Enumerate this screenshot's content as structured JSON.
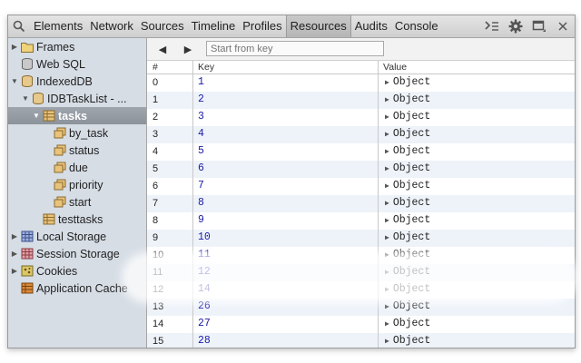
{
  "toolbar": {
    "tabs": [
      "Elements",
      "Network",
      "Sources",
      "Timeline",
      "Profiles",
      "Resources",
      "Audits",
      "Console"
    ],
    "active_tab": "Resources"
  },
  "sidebar": {
    "items": [
      {
        "label": "Frames",
        "icon": "folder-icon",
        "expanded": false
      },
      {
        "label": "Web SQL",
        "icon": "database-icon",
        "expanded": null
      },
      {
        "label": "IndexedDB",
        "icon": "database-icon",
        "expanded": true
      },
      {
        "label": "IDBTaskList - ...",
        "icon": "database-icon",
        "expanded": true
      },
      {
        "label": "tasks",
        "icon": "object-store-icon",
        "expanded": true,
        "selected": true
      },
      {
        "label": "by_task",
        "icon": "index-icon"
      },
      {
        "label": "status",
        "icon": "index-icon"
      },
      {
        "label": "due",
        "icon": "index-icon"
      },
      {
        "label": "priority",
        "icon": "index-icon"
      },
      {
        "label": "start",
        "icon": "index-icon"
      },
      {
        "label": "testtasks",
        "icon": "object-store-icon"
      },
      {
        "label": "Local Storage",
        "icon": "storage-grid-icon",
        "expanded": false
      },
      {
        "label": "Session Storage",
        "icon": "storage-grid-icon",
        "expanded": false
      },
      {
        "label": "Cookies",
        "icon": "cookie-icon",
        "expanded": false
      },
      {
        "label": "Application Cache",
        "icon": "app-cache-icon"
      }
    ]
  },
  "nav": {
    "prev_label": "◀",
    "next_label": "▶",
    "key_placeholder": "Start from key"
  },
  "grid": {
    "columns": [
      "#",
      "Key",
      "Value"
    ],
    "rows": [
      {
        "n": "0",
        "key": "1",
        "value": "Object"
      },
      {
        "n": "1",
        "key": "2",
        "value": "Object"
      },
      {
        "n": "2",
        "key": "3",
        "value": "Object"
      },
      {
        "n": "3",
        "key": "4",
        "value": "Object"
      },
      {
        "n": "4",
        "key": "5",
        "value": "Object"
      },
      {
        "n": "5",
        "key": "6",
        "value": "Object"
      },
      {
        "n": "6",
        "key": "7",
        "value": "Object"
      },
      {
        "n": "7",
        "key": "8",
        "value": "Object"
      },
      {
        "n": "8",
        "key": "9",
        "value": "Object"
      },
      {
        "n": "9",
        "key": "10",
        "value": "Object"
      },
      {
        "n": "10",
        "key": "11",
        "value": "Object"
      },
      {
        "n": "11",
        "key": "12",
        "value": "Object"
      },
      {
        "n": "12",
        "key": "14",
        "value": "Object"
      },
      {
        "n": "13",
        "key": "26",
        "value": "Object"
      },
      {
        "n": "14",
        "key": "27",
        "value": "Object"
      },
      {
        "n": "15",
        "key": "28",
        "value": "Object"
      }
    ]
  }
}
